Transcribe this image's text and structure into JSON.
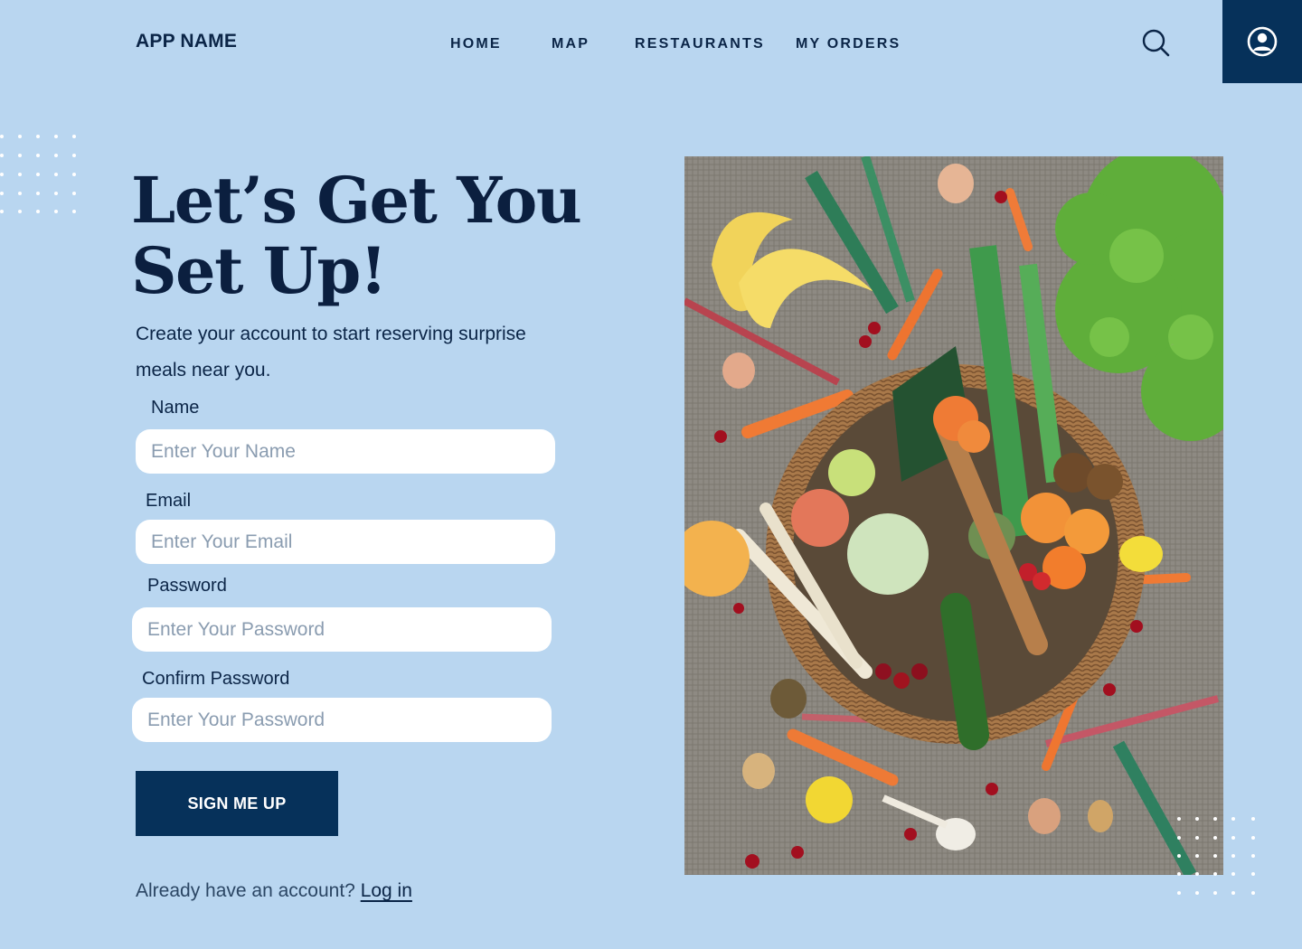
{
  "header": {
    "brand": "APP NAME",
    "nav": [
      {
        "label": "HOME"
      },
      {
        "label": "MAP"
      },
      {
        "label": "RESTAURANTS"
      },
      {
        "label": "MY ORDERS"
      }
    ],
    "search_icon": "search-icon",
    "profile_icon": "user-circle-icon"
  },
  "hero": {
    "title_line1": "Let’s Get You",
    "title_line2": "Set Up!",
    "subtitle": "Create your account to start reserving surprise meals near you."
  },
  "form": {
    "name_label": "Name",
    "name_placeholder": "Enter Your Name",
    "email_label": "Email",
    "email_placeholder": "Enter Your Email",
    "password_label": "Password",
    "password_placeholder": "Enter Your Password",
    "confirm_label": "Confirm Password",
    "confirm_placeholder": "Enter Your Password",
    "submit_label": "SIGN ME UP",
    "login_prompt": "Already have an account?",
    "login_link": "Log in"
  },
  "colors": {
    "background": "#b9d6f0",
    "navy": "#06315a",
    "text": "#0b2547"
  }
}
